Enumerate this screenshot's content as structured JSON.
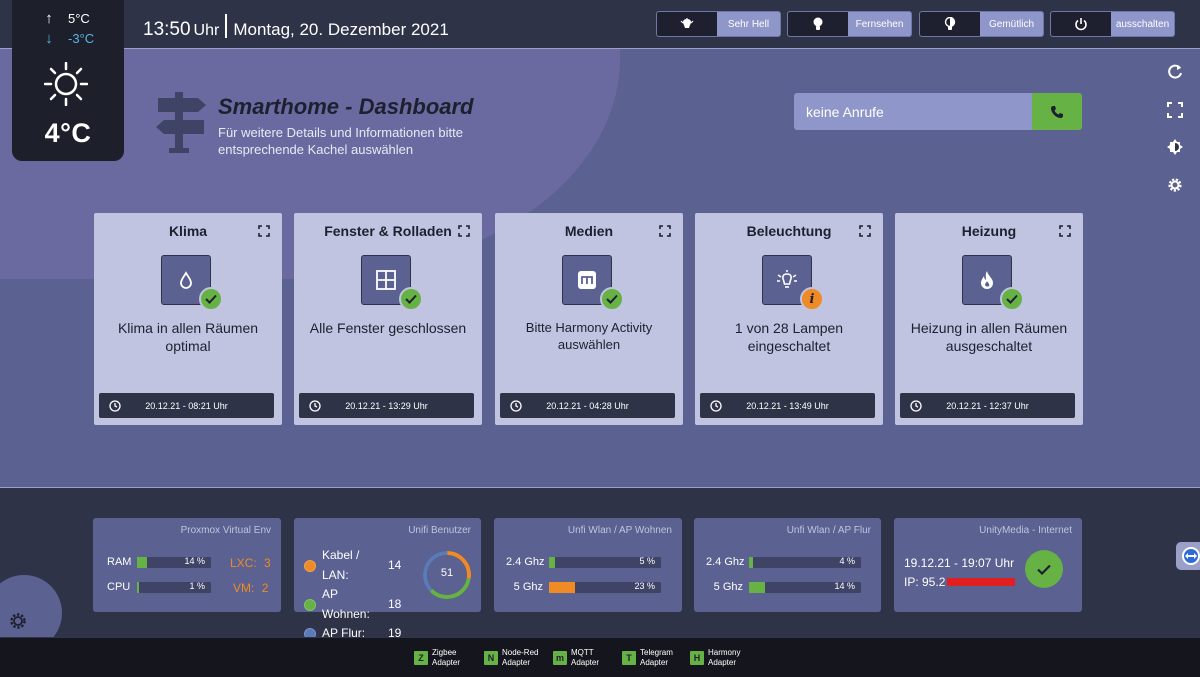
{
  "weather": {
    "high": "5°C",
    "low": "-3°C",
    "current": "4°C"
  },
  "clock": {
    "time": "13:50",
    "uhr": "Uhr",
    "date": "Montag, 20. Dezember 2021"
  },
  "scenes": [
    {
      "label": "Sehr Hell",
      "icon": "bright-bulb-icon"
    },
    {
      "label": "Fernsehen",
      "icon": "bulb-icon"
    },
    {
      "label": "Gemütlich",
      "icon": "dim-bulb-icon"
    },
    {
      "label": "ausschalten",
      "icon": "power-icon"
    }
  ],
  "hero": {
    "title": "Smarthome - Dashboard",
    "subtitle": "Für weitere Details und Informationen bitte entsprechende Kachel auswählen"
  },
  "call": {
    "text": "keine Anrufe"
  },
  "cards": [
    {
      "title": "Klima",
      "message": "Klima in allen Räumen optimal",
      "time": "20.12.21 - 08:21 Uhr",
      "status": "ok"
    },
    {
      "title": "Fenster & Rolladen",
      "message": "Alle Fenster geschlossen",
      "time": "20.12.21 - 13:29 Uhr",
      "status": "ok"
    },
    {
      "title": "Medien",
      "message": "Bitte Harmony Activity auswählen",
      "time": "20.12.21 - 04:28 Uhr",
      "status": "ok"
    },
    {
      "title": "Beleuchtung",
      "message": "1 von 28 Lampen eingeschaltet",
      "time": "20.12.21 - 13:49 Uhr",
      "status": "info"
    },
    {
      "title": "Heizung",
      "message": "Heizung in allen Räumen ausgeschaltet",
      "time": "20.12.21 - 12:37 Uhr",
      "status": "ok"
    }
  ],
  "proxmox": {
    "title": "Proxmox Virtual Env",
    "ram_label": "RAM",
    "ram_value": "14 %",
    "ram_pct": 14,
    "cpu_label": "CPU",
    "cpu_value": "1 %",
    "cpu_pct": 1,
    "lxc_label": "LXC:",
    "lxc_value": "3",
    "vm_label": "VM:",
    "vm_value": "2"
  },
  "unifi_users": {
    "title": "Unifi Benutzer",
    "rows": [
      {
        "label": "Kabel / LAN:",
        "value": "14",
        "color": "#f08a24"
      },
      {
        "label": "AP Wohnen:",
        "value": "18",
        "color": "#66b244"
      },
      {
        "label": "AP Flur:",
        "value": "19",
        "color": "#5a7ab8"
      }
    ],
    "total": "51"
  },
  "wlan_wohnen": {
    "title": "Unfi Wlan / AP Wohnen",
    "g24_label": "2.4 Ghz",
    "g24_value": "5 %",
    "g24_pct": 5,
    "g5_label": "5 Ghz",
    "g5_value": "23 %",
    "g5_pct": 23
  },
  "wlan_flur": {
    "title": "Unfi Wlan / AP Flur",
    "g24_label": "2.4 Ghz",
    "g24_value": "4 %",
    "g24_pct": 4,
    "g5_label": "5 Ghz",
    "g5_value": "14 %",
    "g5_pct": 14
  },
  "internet": {
    "title": "UnityMedia - Internet",
    "time": "19.12.21 - 19:07 Uhr",
    "ip": "IP: 95.2"
  },
  "adapters": [
    {
      "letter": "Z",
      "line1": "Zigbee",
      "line2": "Adapter"
    },
    {
      "letter": "N",
      "line1": "Node-Red",
      "line2": "Adapter"
    },
    {
      "letter": "m",
      "line1": "MQTT",
      "line2": "Adapter"
    },
    {
      "letter": "T",
      "line1": "Telegram",
      "line2": "Adapter"
    },
    {
      "letter": "H",
      "line1": "Harmony",
      "line2": "Adapter"
    }
  ],
  "colors": {
    "ok": "#66b244",
    "warn": "#f08a24",
    "accent": "#5b6191"
  }
}
